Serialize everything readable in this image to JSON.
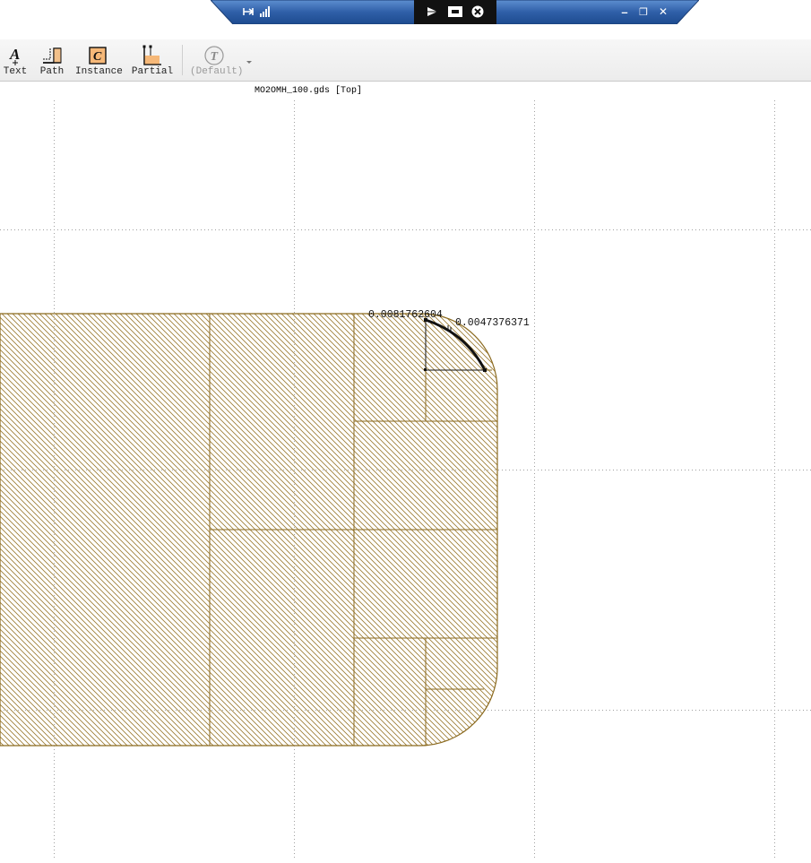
{
  "remote_bar": {
    "pin_icon": "pin-icon",
    "signal_icon": "signal-icon",
    "play_icon": "play-icon",
    "resize_icon": "resize-icon",
    "close_circle_icon": "close-circle-icon",
    "minimize_label": "–",
    "restore_label": "❐",
    "close_label": "✕"
  },
  "toolbar": {
    "tools": [
      {
        "label": "Text",
        "icon": "text-tool-icon"
      },
      {
        "label": "Path",
        "icon": "path-tool-icon"
      },
      {
        "label": "Instance",
        "icon": "instance-tool-icon"
      },
      {
        "label": "Partial",
        "icon": "partial-tool-icon"
      },
      {
        "label": "(Default)",
        "icon": "default-text-style-icon",
        "disabled": true
      }
    ],
    "dropdown_icon": "dropdown-arrow-icon"
  },
  "document": {
    "title": "MO2OMH_100.gds [Top]"
  },
  "measurements": {
    "dx": "0.0081762604",
    "dy": "0.0047376371"
  },
  "colors": {
    "shape_stroke": "#8b6a1f",
    "hatch": "#9a7a30",
    "grid_dot": "#9a9a9a",
    "rd_bar": "#2f5fa8",
    "rd_center": "#111111"
  }
}
